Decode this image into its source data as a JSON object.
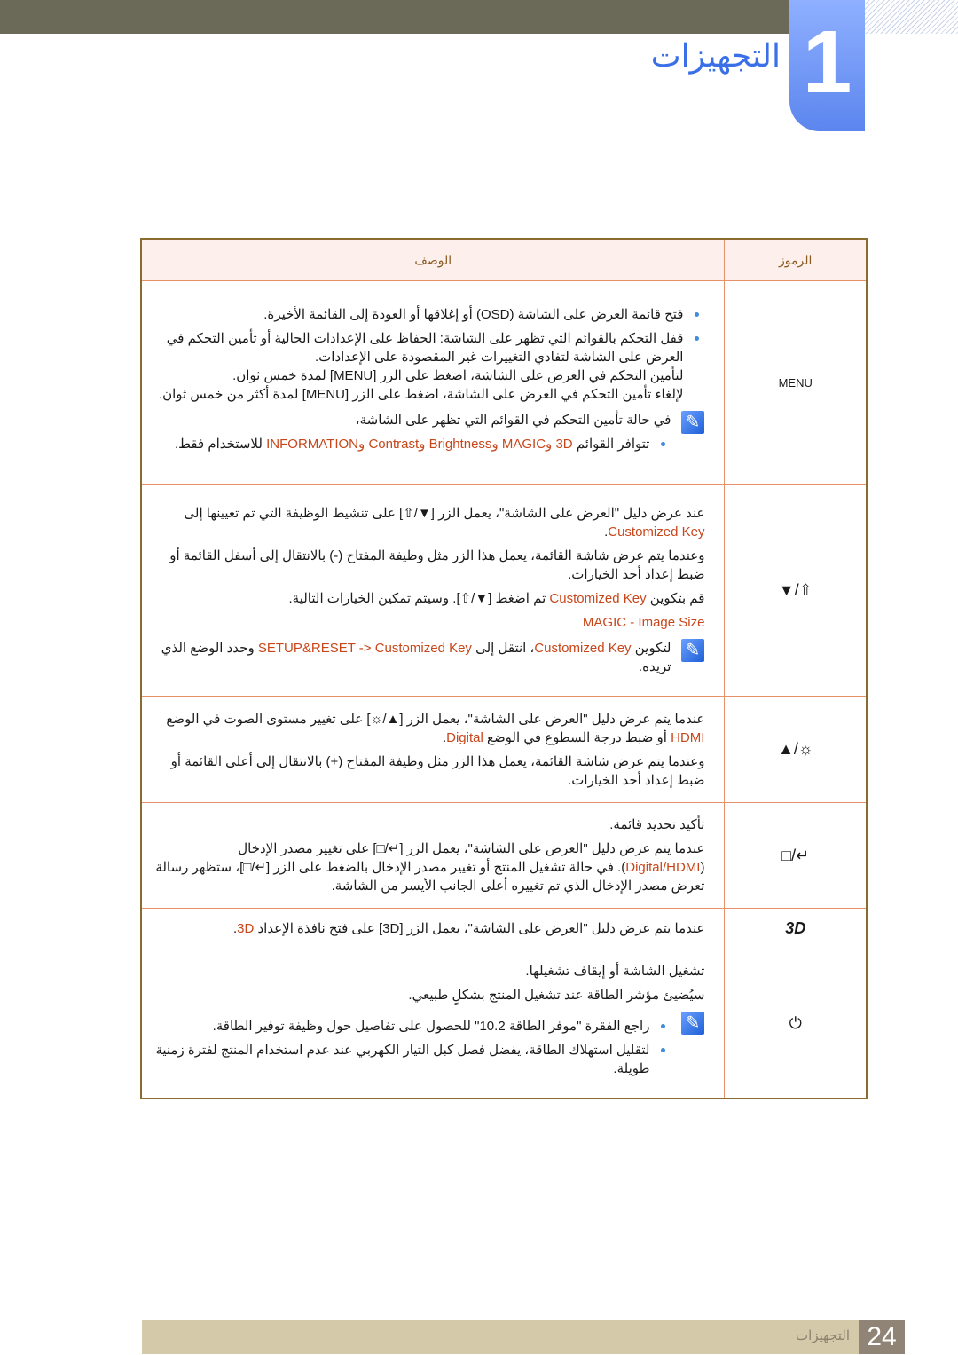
{
  "header": {
    "chapter_number": "1",
    "chapter_title": "التجهيزات"
  },
  "table": {
    "col_symbols": "الرموز",
    "col_description": "الوصف",
    "rows": [
      {
        "symbol": "MENU",
        "symbol_icon": "menu-text",
        "bullets": [
          "فتح قائمة العرض على الشاشة (OSD) أو إغلاقها أو العودة إلى القائمة الأخيرة.",
          "قفل التحكم بالقوائم التي تظهر على الشاشة: الحفاظ على الإعدادات الحالية أو تأمين التحكم في العرض على الشاشة لتفادي التغييرات غير المقصودة على الإعدادات.",
          "لتأمين التحكم في العرض على الشاشة، اضغط على الزر [MENU] لمدة خمس ثوان.",
          "لإلغاء تأمين التحكم في العرض على الشاشة، اضغط على الزر [MENU] لمدة أكثر من خمس ثوان."
        ],
        "note_title": "في حالة تأمين التحكم في القوائم التي تظهر على الشاشة،",
        "note_bullet_pre": "تتوافر القوائم ",
        "note_bullet_hl": "3D وMAGIC وBrightness وContrast وINFORMATION",
        "note_bullet_post": " للاستخدام فقط."
      },
      {
        "symbol": "▼/⇧",
        "symbol_icon": "down-custom-key",
        "p1_pre": "عند عرض دليل \"العرض على الشاشة\"، يعمل الزر [▼/⇧] على تنشيط الوظيفة التي تم تعيينها إلى ",
        "p1_hl": "Customized Key",
        "p1_post": ".",
        "p2": "وعندما يتم عرض شاشة القائمة، يعمل هذا الزر مثل وظيفة المفتاح (-) بالانتقال إلى أسفل القائمة أو ضبط إعداد أحد الخيارات.",
        "p3_pre": "قم بتكوين ",
        "p3_hl": "Customized Key",
        "p3_post": " ثم اضغط [▼/⇧]. وسيتم تمكين الخيارات التالية.",
        "options": "MAGIC - Image Size",
        "note_pre": "لتكوين ",
        "note_hl1": "Customized Key",
        "note_mid": "، انتقل إلى ",
        "note_hl2": "SETUP&RESET -> Customized Key",
        "note_post": " وحدد الوضع الذي تريده."
      },
      {
        "symbol": "▲/☼",
        "symbol_icon": "up-brightness",
        "p1_pre": "عندما يتم عرض دليل \"العرض على الشاشة\"، يعمل الزر [▲/☼] على تغيير مستوى الصوت في الوضع ",
        "p1_hl1": "HDMI",
        "p1_mid": " أو ضبط درجة السطوع في الوضع ",
        "p1_hl2": "Digital",
        "p1_post": ".",
        "p2": "وعندما يتم عرض شاشة القائمة، يعمل هذا الزر مثل وظيفة المفتاح (+) بالانتقال إلى أعلى القائمة أو ضبط إعداد أحد الخيارات."
      },
      {
        "symbol": "□/↵",
        "symbol_icon": "source-enter",
        "p1": "تأكيد تحديد قائمة.",
        "p2_pre": "عندما يتم عرض دليل \"العرض على الشاشة\"، يعمل الزر [↵/□] على تغيير مصدر الإدخال (",
        "p2_hl": "Digital/HDMI",
        "p2_post": "). في حالة تشغيل المنتج أو تغيير مصدر الإدخال بالضغط على الزر [↵/□]، ستظهر رسالة تعرض مصدر الإدخال الذي تم تغييره أعلى الجانب الأيسر من الشاشة."
      },
      {
        "symbol": "3D",
        "symbol_icon": "3d",
        "p1_pre": "عندما يتم عرض دليل \"العرض على الشاشة\"، يعمل الزر [3D] على فتح نافذة الإعداد ",
        "p1_hl": "3D",
        "p1_post": "."
      },
      {
        "symbol": "⏻",
        "symbol_icon": "power",
        "p1": "تشغيل الشاشة أو إيقاف تشغيلها.",
        "p2": "سيُضيئ مؤشر الطاقة عند تشغيل المنتج بشكلٍ طبيعي.",
        "note_bullets": [
          "راجع الفقرة \"موفر الطاقة 10.2\" للحصول على تفاصيل حول وظيفة توفير الطاقة.",
          "لتقليل استهلاك الطاقة، يفضل فصل كبل التيار الكهربي عند عدم استخدام المنتج لفترة زمنية طويلة."
        ]
      }
    ]
  },
  "footer": {
    "page_number": "24",
    "section_title": "التجهيزات"
  },
  "colors": {
    "accent": "#c8461a",
    "bullet": "#3e8de0",
    "chapter_blue": "#3a6fe8",
    "border": "#e7916a"
  }
}
